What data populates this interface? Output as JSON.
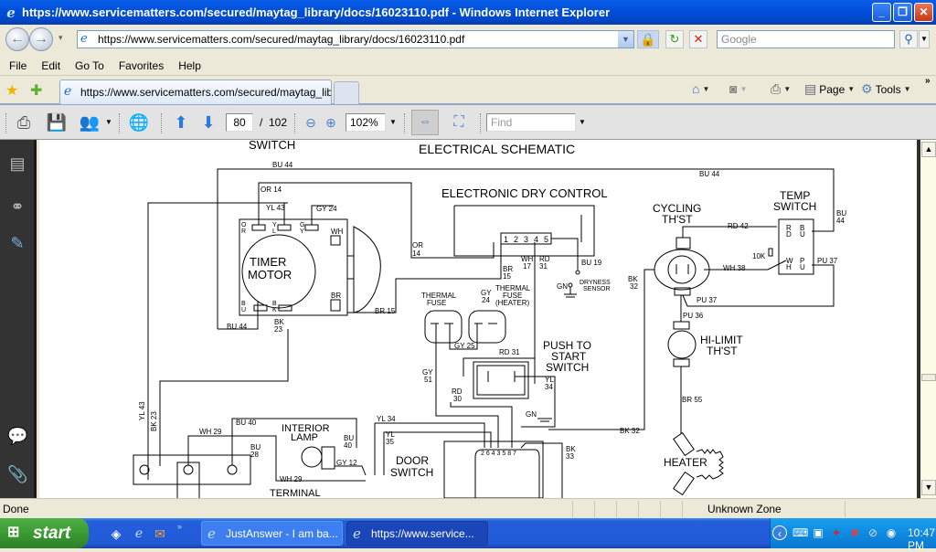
{
  "window": {
    "title": "https://www.servicematters.com/secured/maytag_library/docs/16023110.pdf - Windows Internet Explorer",
    "minimize": "_",
    "restore": "❐",
    "close": "✕"
  },
  "nav": {
    "back": "←",
    "forward": "→",
    "history_dropdown": "▾",
    "address": "https://www.servicematters.com/secured/maytag_library/docs/16023110.pdf",
    "refresh": "↻",
    "stop": "✕",
    "search_placeholder": "Google",
    "search_icon": "⚲"
  },
  "menu": [
    "File",
    "Edit",
    "Go To",
    "Favorites",
    "Help"
  ],
  "tabs": {
    "active_tab": "https://www.servicematters.com/secured/maytag_lib...",
    "commands": {
      "home": "⌂",
      "feeds": "◙",
      "print": "⎙",
      "page": "Page",
      "tools": "Tools",
      "more": "»"
    }
  },
  "pdf_toolbar": {
    "current_page": "80",
    "page_separator": "/",
    "total_pages": "102",
    "zoom": "102%",
    "find_placeholder": "Find"
  },
  "document": {
    "heading": "ELECTRICAL SCHEMATIC",
    "cut_heading": "SWITCH",
    "components": {
      "timer_motor": [
        "TIMER",
        "MOTOR"
      ],
      "electronic_dry_control": "ELECTRONIC DRY CONTROL",
      "cycling_thermostat": [
        "CYCLING",
        "TH'ST"
      ],
      "temp_switch": [
        "TEMP",
        "SWITCH"
      ],
      "thermal_fuse": [
        "THERMAL",
        "FUSE"
      ],
      "thermal_fuse_heater": [
        "THERMAL",
        "FUSE",
        "(HEATER)"
      ],
      "push_to_start": [
        "PUSH TO",
        "START",
        "SWITCH"
      ],
      "hi_limit": [
        "HI-LIMIT",
        "TH'ST"
      ],
      "heater": "HEATER",
      "interior_lamp": [
        "INTERIOR",
        "LAMP"
      ],
      "door_switch": [
        "DOOR",
        "SWITCH"
      ],
      "terminal": "TERMINAL",
      "dryness_sensor": [
        "DRYNESS",
        "SENSOR"
      ]
    },
    "wire_labels": {
      "bu44_top": "BU 44",
      "bu44_right": "BU 44",
      "bu44_vert": [
        "BU",
        "44"
      ],
      "bu44_bottom": "BU 44",
      "or14": "OR 14",
      "or14_b": [
        "OR",
        "14"
      ],
      "yl43": "YL 43",
      "gy24": "GY 24",
      "gy24_b": [
        "GY",
        "24"
      ],
      "br15": "BR 15",
      "br15_b": [
        "BR",
        "15"
      ],
      "bk23": [
        "BK",
        "23"
      ],
      "wh17": [
        "WH",
        "17"
      ],
      "rd31": [
        "RD",
        "31"
      ],
      "bu19": "BU 19",
      "gn": "GN",
      "bk32_a": [
        "BK",
        "32"
      ],
      "bk32_b": "BK 32",
      "rd42": "RD 42",
      "wh38": "WH 38",
      "pu37_a": "PU 37",
      "pu37_b": "PU 37",
      "pu36": "PU 36",
      "k10": "10K",
      "br55": "BR 55",
      "gy25": "GY 25",
      "rd31_b": "RD 31",
      "gy51": [
        "GY",
        "51"
      ],
      "rd30": [
        "RD",
        "30"
      ],
      "yl34": [
        "YL",
        "34"
      ],
      "gn_b": "GN",
      "yl34_b": "YL 34",
      "yl35": [
        "YL",
        "35"
      ],
      "bk33": [
        "BK",
        "33"
      ],
      "bu40": "BU 40",
      "bu40_b": [
        "BU",
        "40"
      ],
      "gy12": "GY 12",
      "wh29": "WH 29",
      "wh29_b": "WH 29",
      "bu28": [
        "BU",
        "28"
      ],
      "yl43_vert": "YL 43",
      "bk23_vert": "BK 23",
      "pins_edc": [
        "1",
        "2",
        "3",
        "4",
        "5"
      ],
      "pins_door": "2 6 4 3   5 8 7",
      "ts_rd": [
        "R",
        "D"
      ],
      "ts_bu": [
        "B",
        "U"
      ],
      "ts_wh": [
        "W",
        "H"
      ],
      "ts_pu": [
        "P",
        "U"
      ],
      "tm_or": [
        "O",
        "R"
      ],
      "tm_yl": [
        "Y",
        "L"
      ],
      "tm_gy": [
        "G",
        "Y"
      ],
      "tm_wh": "WH",
      "tm_br": "BR",
      "tm_bu": [
        "B",
        "U"
      ],
      "tm_bk": [
        "B",
        "K"
      ]
    }
  },
  "status": {
    "text": "Done",
    "zone": "Unknown Zone"
  },
  "taskbar": {
    "start": "start",
    "tasks": [
      "JustAnswer - I am ba...",
      "https://www.service..."
    ],
    "clock": "10:47 PM"
  }
}
